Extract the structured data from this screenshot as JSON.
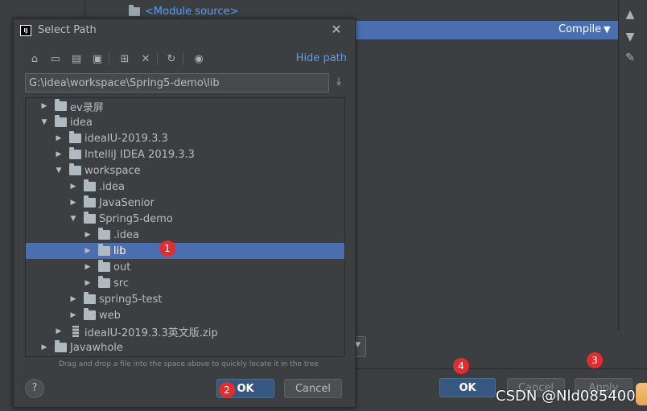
{
  "background": {
    "module_source": "<Module source>",
    "compile_label": "Compile",
    "ok_label": "OK",
    "cancel_label": "Cancel",
    "apply_label": "Apply"
  },
  "dialog": {
    "title": "Select Path",
    "hide_path": "Hide path",
    "path_value": "G:\\idea\\workspace\\Spring5-demo\\lib",
    "hint": "Drag and drop a file into the space above to quickly locate it in the tree",
    "help": "?",
    "ok_label": "OK",
    "cancel_label": "Cancel"
  },
  "tree": [
    {
      "label": "ev录屏",
      "expanded": false,
      "type": "folder"
    },
    {
      "label": "idea",
      "expanded": true,
      "type": "folder"
    },
    {
      "label": "ideaIU-2019.3.3",
      "expanded": false,
      "type": "folder"
    },
    {
      "label": "IntelliJ IDEA 2019.3.3",
      "expanded": false,
      "type": "folder"
    },
    {
      "label": "workspace",
      "expanded": true,
      "type": "folder"
    },
    {
      "label": ".idea",
      "expanded": false,
      "type": "folder"
    },
    {
      "label": "JavaSenior",
      "expanded": false,
      "type": "folder"
    },
    {
      "label": "Spring5-demo",
      "expanded": true,
      "type": "folder"
    },
    {
      "label": ".idea",
      "expanded": false,
      "type": "folder"
    },
    {
      "label": "lib",
      "expanded": false,
      "type": "folder",
      "selected": true
    },
    {
      "label": "out",
      "expanded": false,
      "type": "folder"
    },
    {
      "label": "src",
      "expanded": false,
      "type": "folder"
    },
    {
      "label": "spring5-test",
      "expanded": false,
      "type": "folder"
    },
    {
      "label": "web",
      "expanded": false,
      "type": "folder"
    },
    {
      "label": "ideaIU-2019.3.3英文版.zip",
      "expanded": false,
      "type": "zip"
    },
    {
      "label": "Javawhole",
      "expanded": false,
      "type": "folder"
    }
  ],
  "badges": [
    "1",
    "2",
    "3",
    "4"
  ],
  "watermark": "CSDN @Nld085400",
  "colors": {
    "selection": "#4b6eaf",
    "link": "#589df6",
    "badge": "#e02e2e",
    "primary_button": "#365880"
  }
}
